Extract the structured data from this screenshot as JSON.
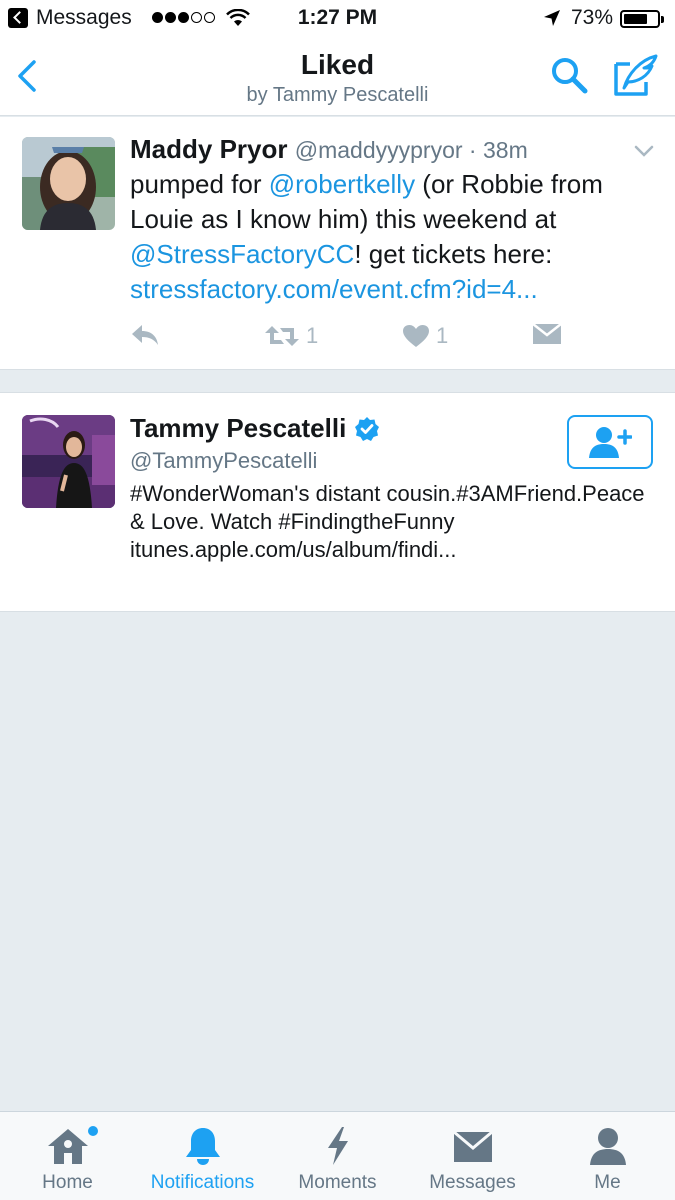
{
  "status_bar": {
    "back_app": "Messages",
    "time": "1:27 PM",
    "battery_text": "73%",
    "battery_level": 0.73,
    "signal_bars_filled": 3,
    "signal_bars_total": 5
  },
  "nav": {
    "title": "Liked",
    "subtitle": "by Tammy Pescatelli",
    "icons": [
      "back-chevron-icon",
      "search-icon",
      "compose-icon"
    ]
  },
  "tweet": {
    "name": "Maddy Pryor",
    "handle": "@maddyyypryor",
    "time": "38m",
    "text_parts": [
      {
        "text": "pumped for ",
        "link": false
      },
      {
        "text": "@robertkelly",
        "link": true
      },
      {
        "text": " (or Robbie from Louie as I know him) this weekend at ",
        "link": false
      },
      {
        "text": "@StressFactoryCC",
        "link": true
      },
      {
        "text": "! get tickets here: ",
        "link": false
      },
      {
        "text": "stressfactory.com/event.cfm?id=4...",
        "link": true
      }
    ],
    "retweet_count": "1",
    "like_count": "1"
  },
  "user_card": {
    "name": "Tammy Pescatelli",
    "verified": true,
    "handle": "@TammyPescatelli",
    "bio": "#WonderWoman's distant cousin.#3AMFriend.Peace & Love. Watch #FindingtheFunny itunes.apple.com/us/album/findi..."
  },
  "tabs": [
    {
      "label": "Home",
      "icon": "home-icon",
      "active": false,
      "has_dot": true
    },
    {
      "label": "Notifications",
      "icon": "bell-icon",
      "active": true,
      "has_dot": false
    },
    {
      "label": "Moments",
      "icon": "lightning-icon",
      "active": false,
      "has_dot": false
    },
    {
      "label": "Messages",
      "icon": "envelope-icon",
      "active": false,
      "has_dot": false
    },
    {
      "label": "Me",
      "icon": "person-icon",
      "active": false,
      "has_dot": false
    }
  ],
  "colors": {
    "accent": "#1da1f2",
    "link": "#1b95e0",
    "muted": "#657786",
    "icon_gray": "#aab8c2",
    "tab_gray": "#657786",
    "background": "#e6ecf0"
  }
}
